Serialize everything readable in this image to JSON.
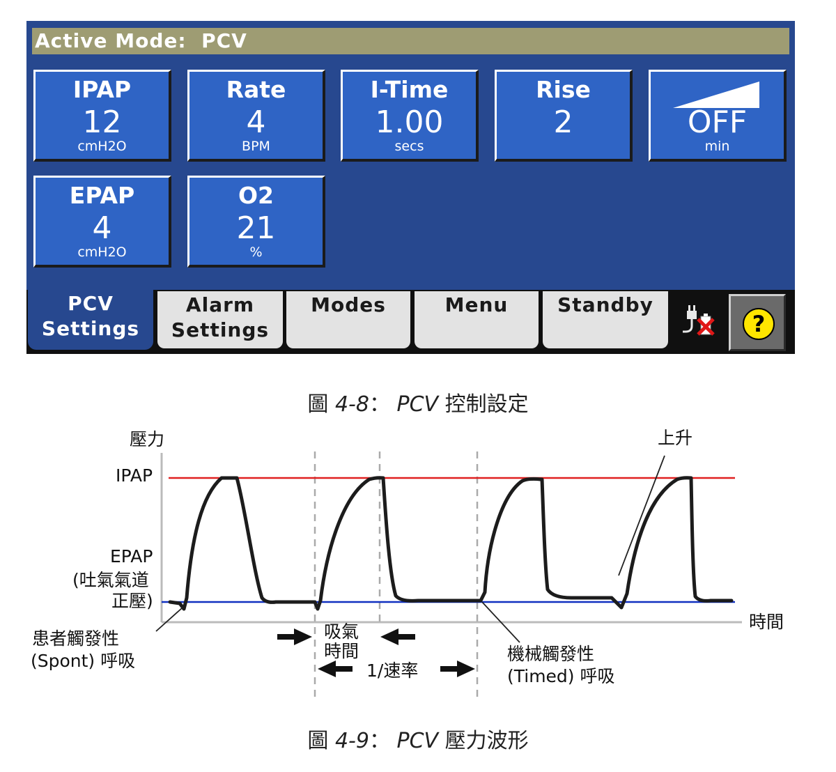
{
  "screen": {
    "status_prefix": "Active Mode:",
    "status_mode": "PCV",
    "tiles": [
      {
        "label": "IPAP",
        "value": "12",
        "unit": "cmH2O"
      },
      {
        "label": "Rate",
        "value": "4",
        "unit": "BPM"
      },
      {
        "label": "I-Time",
        "value": "1.00",
        "unit": "secs"
      },
      {
        "label": "Rise",
        "value": "2",
        "unit": ""
      },
      {
        "label": "",
        "value": "OFF",
        "unit": "min",
        "icon": "ramp-icon"
      },
      {
        "label": "EPAP",
        "value": "4",
        "unit": "cmH2O"
      },
      {
        "label": "O2",
        "value": "21",
        "unit": "%"
      }
    ],
    "tabs": [
      {
        "line1": "PCV",
        "line2": "Settings",
        "active": true
      },
      {
        "line1": "Alarm",
        "line2": "Settings",
        "active": false
      },
      {
        "line1": "Modes",
        "line2": "",
        "active": false
      },
      {
        "line1": "Menu",
        "line2": "",
        "active": false
      },
      {
        "line1": "Standby",
        "line2": "",
        "active": false
      }
    ],
    "power_icon": "ac-power-disconnected-icon",
    "help_label": "?"
  },
  "caption1": {
    "prefix": "圖",
    "fig": "4-8",
    "sep": "：",
    "mode": "PCV",
    "text": "控制設定"
  },
  "caption2": {
    "prefix": "圖",
    "fig": "4-9",
    "sep": "：",
    "mode": "PCV",
    "text": "壓力波形"
  },
  "diagram": {
    "y_axis_label": "壓力",
    "x_axis_label": "時間",
    "ipap_label": "IPAP",
    "epap_label_1": "EPAP",
    "epap_label_2": "(吐氣氣道",
    "epap_label_3": "正壓)",
    "rise_label": "上升",
    "spont_label_1": "患者觸發性",
    "spont_label_2": "(Spont) 呼吸",
    "timed_label_1": "機械觸發性",
    "timed_label_2": "(Timed) 呼吸",
    "insp_label_1": "吸氣",
    "insp_label_2": "時間",
    "rate_label": "1/速率",
    "ipap_color": "#e02020",
    "epap_color": "#1030c0"
  }
}
